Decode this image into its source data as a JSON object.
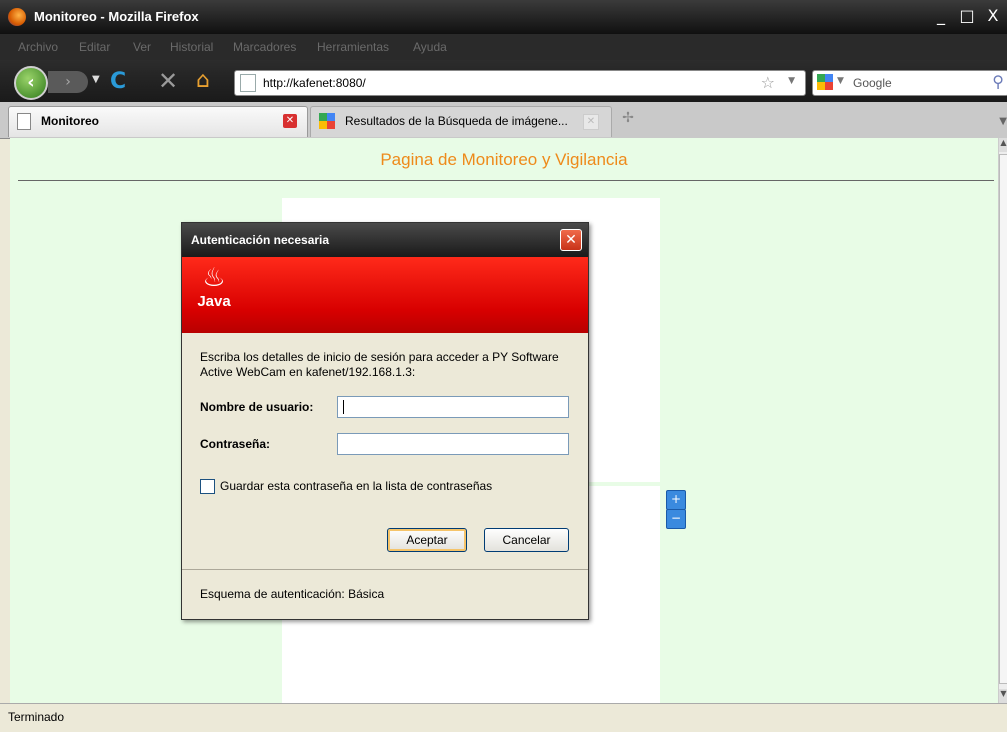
{
  "window": {
    "title": "Monitoreo - Mozilla Firefox",
    "minimize": "_",
    "maximize": "□",
    "close": "X"
  },
  "menu": [
    "Archivo",
    "Editar",
    "Ver",
    "Historial",
    "Marcadores",
    "Herramientas",
    "Ayuda"
  ],
  "nav": {
    "url": "http://kafenet:8080/",
    "search_placeholder": "Google"
  },
  "tabs": [
    {
      "label": "Monitoreo"
    },
    {
      "label": "Resultados de la Búsqueda de imágene..."
    }
  ],
  "page": {
    "heading": "Pagina de Monitoreo y Vigilancia",
    "zoom_in": "+",
    "zoom_out": "−"
  },
  "status": "Terminado",
  "dialog": {
    "title": "Autenticación necesaria",
    "brand": "Java",
    "message": "Escriba los detalles de inicio de sesión para acceder a PY Software Active WebCam en kafenet/192.168.1.3:",
    "username_label": "Nombre de usuario:",
    "username_value": "",
    "password_label": "Contraseña:",
    "password_value": "",
    "remember_label": "Guardar esta contraseña en la lista de contraseñas",
    "remember_checked": false,
    "ok_label": "Aceptar",
    "cancel_label": "Cancelar",
    "scheme": "Esquema de autenticación: Básica"
  },
  "colors": {
    "page_bg": "#e8fce6",
    "heading": "#ee8a1a",
    "banner": "#d80000"
  }
}
